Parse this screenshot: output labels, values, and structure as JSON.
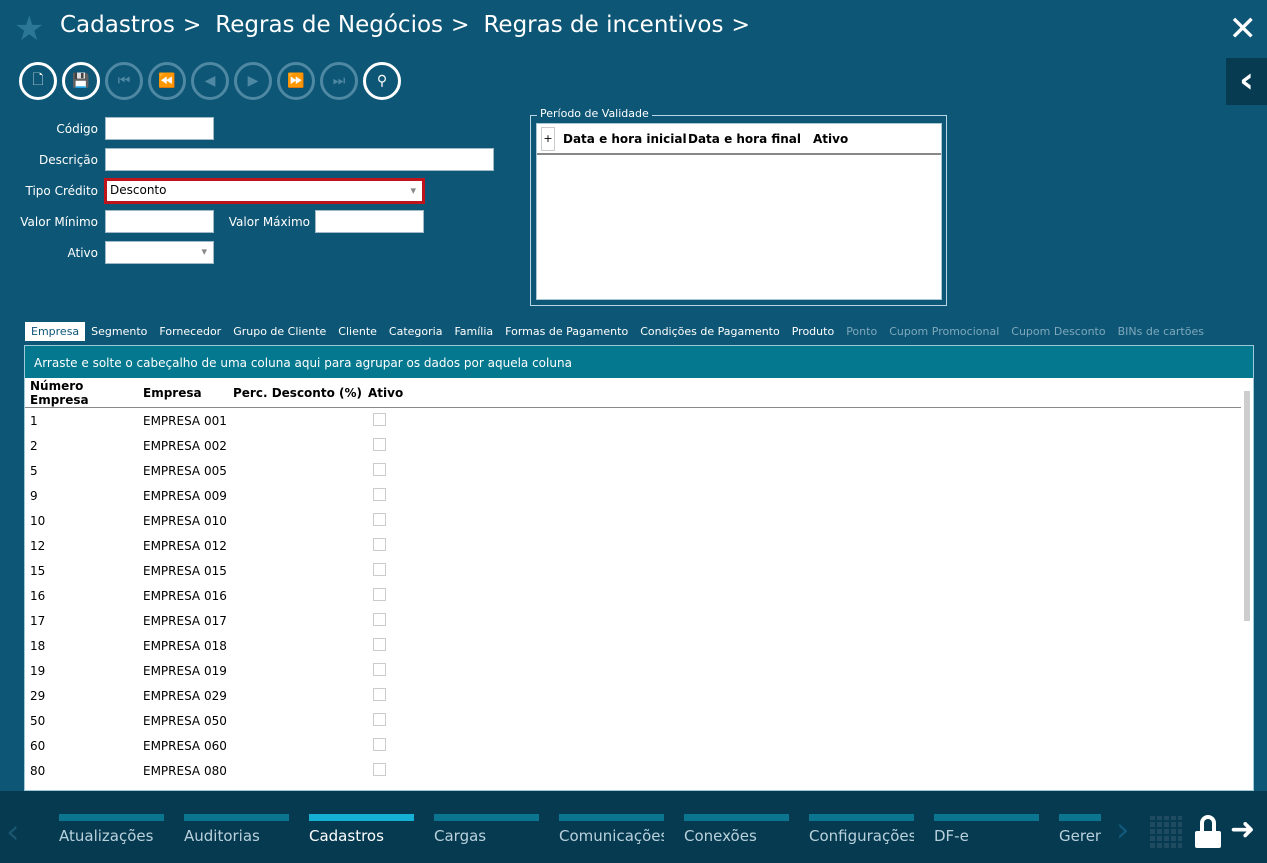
{
  "breadcrumb": [
    "Cadastros",
    "Regras de Negócios",
    "Regras de incentivos"
  ],
  "toolbar": {
    "buttons": [
      {
        "name": "new-document",
        "icon": "🗋",
        "enabled": true
      },
      {
        "name": "save",
        "icon": "💾",
        "enabled": true
      },
      {
        "name": "first",
        "icon": "⏮",
        "enabled": false
      },
      {
        "name": "rewind",
        "icon": "⏪",
        "enabled": false
      },
      {
        "name": "previous",
        "icon": "◀",
        "enabled": false
      },
      {
        "name": "next",
        "icon": "▶",
        "enabled": false
      },
      {
        "name": "fast-forward",
        "icon": "⏩",
        "enabled": false
      },
      {
        "name": "last",
        "icon": "⏭",
        "enabled": false
      },
      {
        "name": "search",
        "icon": "⚲",
        "enabled": true
      }
    ]
  },
  "form": {
    "codigo_label": "Código",
    "codigo_value": "",
    "descricao_label": "Descrição",
    "descricao_value": "",
    "tipo_label": "Tipo Crédito",
    "tipo_value": "Desconto",
    "valor_min_label": "Valor Mínimo",
    "valor_min_value": "",
    "valor_max_label": "Valor Máximo",
    "valor_max_value": "",
    "ativo_label": "Ativo",
    "ativo_value": ""
  },
  "periodo": {
    "legend": "Período de Validade",
    "add": "+",
    "columns": [
      "Data e hora inicial",
      "Data e hora final",
      "Ativo"
    ]
  },
  "tabs": [
    {
      "label": "Empresa",
      "state": "active"
    },
    {
      "label": "Segmento"
    },
    {
      "label": "Fornecedor"
    },
    {
      "label": "Grupo de Cliente"
    },
    {
      "label": "Cliente"
    },
    {
      "label": "Categoria"
    },
    {
      "label": "Família"
    },
    {
      "label": "Formas de Pagamento"
    },
    {
      "label": "Condições de Pagamento"
    },
    {
      "label": "Produto"
    },
    {
      "label": "Ponto",
      "state": "disabled"
    },
    {
      "label": "Cupom Promocional",
      "state": "disabled"
    },
    {
      "label": "Cupom Desconto",
      "state": "disabled"
    },
    {
      "label": "BINs de cartões",
      "state": "disabled"
    }
  ],
  "grid": {
    "group_hint": "Arraste e solte o cabeçalho de uma coluna aqui para agrupar os dados por aquela coluna",
    "columns": [
      "Número Empresa",
      "Empresa",
      "Perc. Desconto (%)",
      "Ativo"
    ],
    "rows": [
      [
        "1",
        "EMPRESA 001"
      ],
      [
        "2",
        "EMPRESA 002"
      ],
      [
        "5",
        "EMPRESA 005"
      ],
      [
        "9",
        "EMPRESA 009"
      ],
      [
        "10",
        "EMPRESA 010"
      ],
      [
        "12",
        "EMPRESA 012"
      ],
      [
        "15",
        "EMPRESA 015"
      ],
      [
        "16",
        "EMPRESA 016"
      ],
      [
        "17",
        "EMPRESA 017"
      ],
      [
        "18",
        "EMPRESA 018"
      ],
      [
        "19",
        "EMPRESA 019"
      ],
      [
        "29",
        "EMPRESA 029"
      ],
      [
        "50",
        "EMPRESA 050"
      ],
      [
        "60",
        "EMPRESA 060"
      ],
      [
        "80",
        "EMPRESA 080"
      ]
    ]
  },
  "bottom_nav": {
    "items": [
      "Atualizações",
      "Auditorias",
      "Cadastros",
      "Cargas",
      "Comunicações",
      "Conexões",
      "Configurações",
      "DF-e",
      "Geren"
    ],
    "active": "Cadastros"
  },
  "colors": {
    "background": "#0d5675",
    "accent": "#15b0d4",
    "highlight_border": "#c0141c"
  }
}
